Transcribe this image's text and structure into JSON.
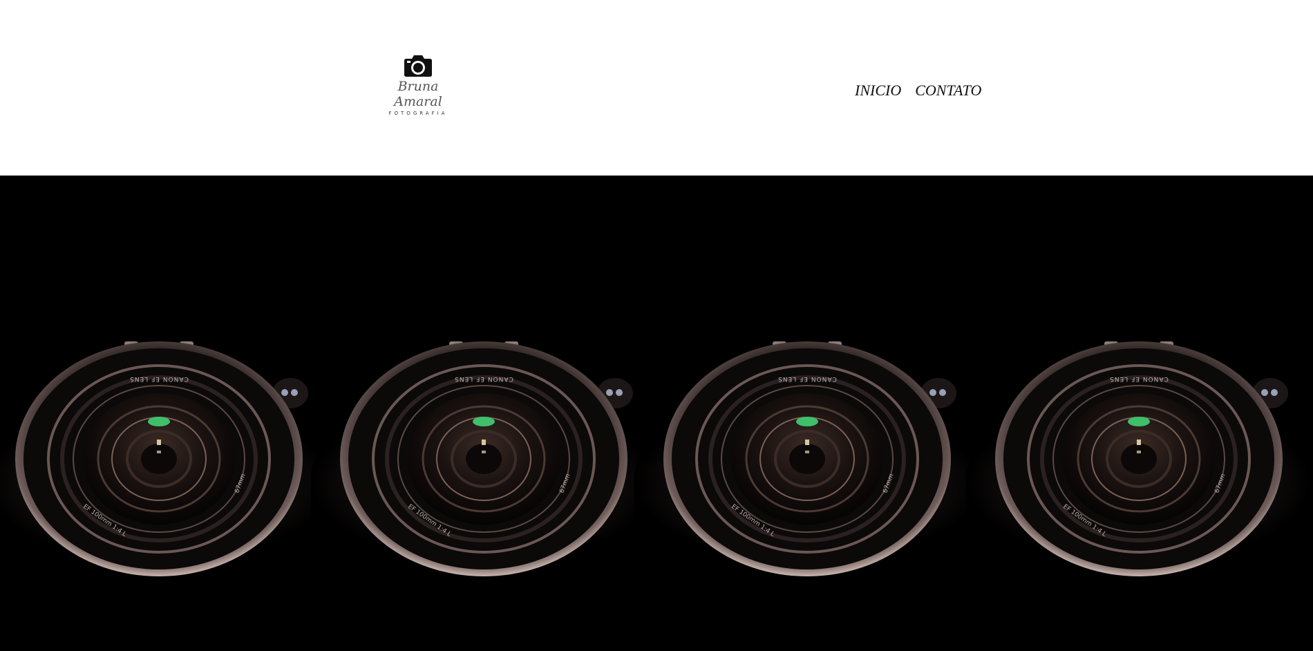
{
  "header": {
    "logo": {
      "icon": "camera-icon",
      "name": "Bruna Amaral",
      "subtitle": "FOTOGRAFIA"
    },
    "nav": [
      {
        "label": "INICIO"
      },
      {
        "label": "CONTATO"
      }
    ]
  },
  "hero": {
    "image": "camera-lens-photo",
    "repeat_count": 4,
    "lens_text_top": "CANON EF LENS",
    "lens_text_left": "EF 100mm 1:4 L",
    "lens_text_right": "67mm"
  },
  "colors": {
    "background": "#ffffff",
    "hero_background": "#000000",
    "lens_glint": "#3fbf6a"
  }
}
